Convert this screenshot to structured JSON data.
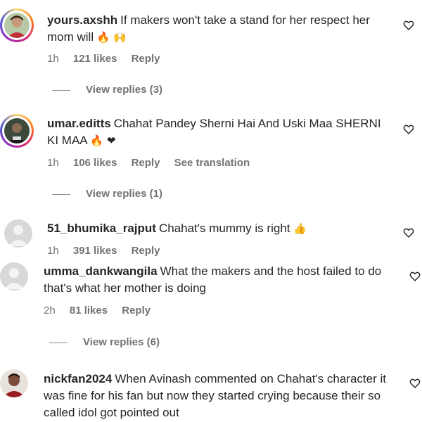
{
  "comments": [
    {
      "username": "yours.axshh",
      "text": "If makers won't take a stand for her respect her mom will",
      "emoji": "🔥 🙌",
      "time": "1h",
      "likes": "121 likes",
      "reply": "Reply",
      "view_replies": "View replies (3)"
    },
    {
      "username": "umar.editts",
      "text": "Chahat Pandey Sherni Hai And Uski Maa SHERNI KI MAA",
      "emoji": "🔥 ❤",
      "time": "1h",
      "likes": "106 likes",
      "reply": "Reply",
      "translation": "See translation",
      "view_replies": "View replies (1)"
    },
    {
      "username": "51_bhumika_rajput",
      "text": "Chahat's mummy is right",
      "emoji": "👍",
      "time": "1h",
      "likes": "391 likes",
      "reply": "Reply"
    },
    {
      "username": "umma_dankwangila",
      "text": "What the makers and the host failed to do that's what her mother is doing",
      "time": "2h",
      "likes": "81 likes",
      "reply": "Reply",
      "view_replies": "View replies (6)"
    },
    {
      "username": "nickfan2024",
      "text": "When Avinash commented on Chahat's character it was fine for his fan but now they started crying because their so called idol got pointed out"
    }
  ],
  "colors": {
    "text": "#262626",
    "secondary": "#737373",
    "story_ring": "#d62976"
  },
  "icons": {
    "like": "heart-outline-icon"
  }
}
